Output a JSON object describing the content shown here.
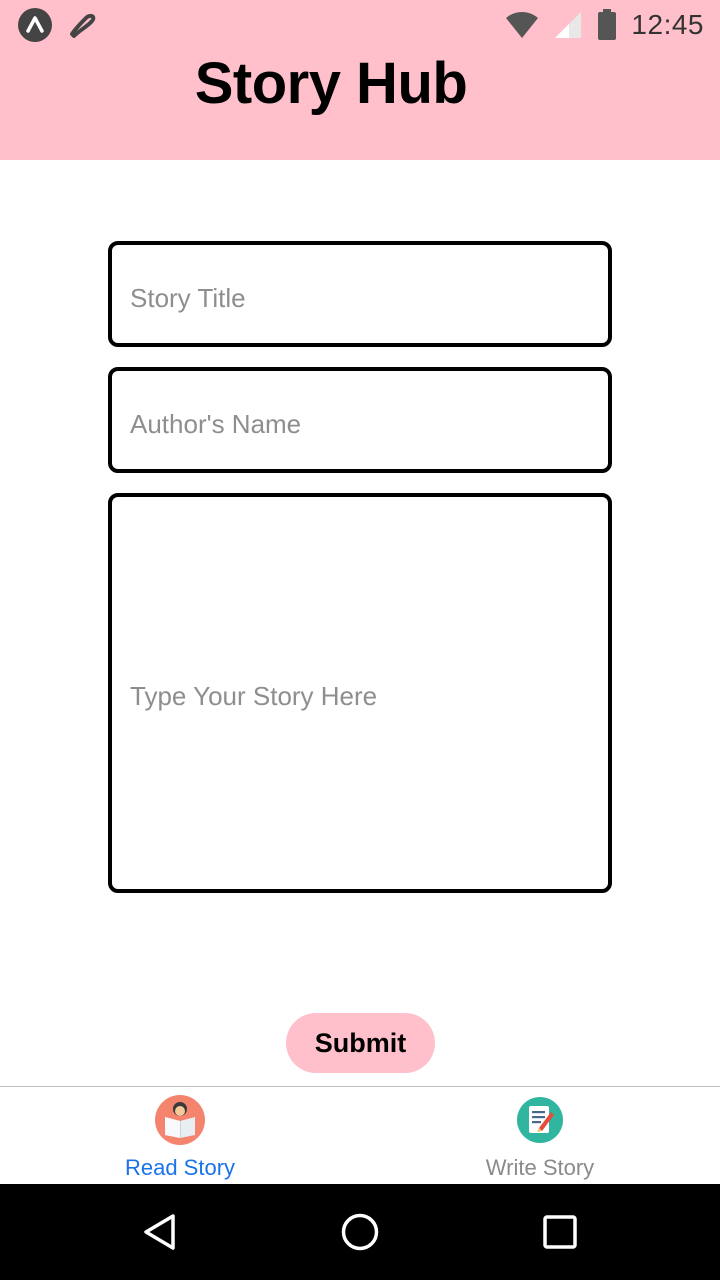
{
  "status_bar": {
    "time": "12:45",
    "icons": [
      "app-a-icon",
      "app-b-icon",
      "wifi-icon",
      "cellular-icon",
      "battery-icon"
    ]
  },
  "header": {
    "title": "Story Hub",
    "background": "#ffc0cb"
  },
  "form": {
    "title_placeholder": "Story Title",
    "author_placeholder": "Author's Name",
    "story_placeholder": "Type Your Story Here",
    "submit_label": "Submit"
  },
  "tabs": [
    {
      "label": "Read Story",
      "icon": "reading-book-icon",
      "active": true
    },
    {
      "label": "Write Story",
      "icon": "write-note-icon",
      "active": false
    }
  ],
  "colors": {
    "accent_pink": "#ffc0cb",
    "active_tab": "#1a73e8",
    "inactive_tab": "#8a8a8a"
  },
  "nav": {
    "icons": [
      "back-icon",
      "home-icon",
      "recents-icon"
    ]
  }
}
